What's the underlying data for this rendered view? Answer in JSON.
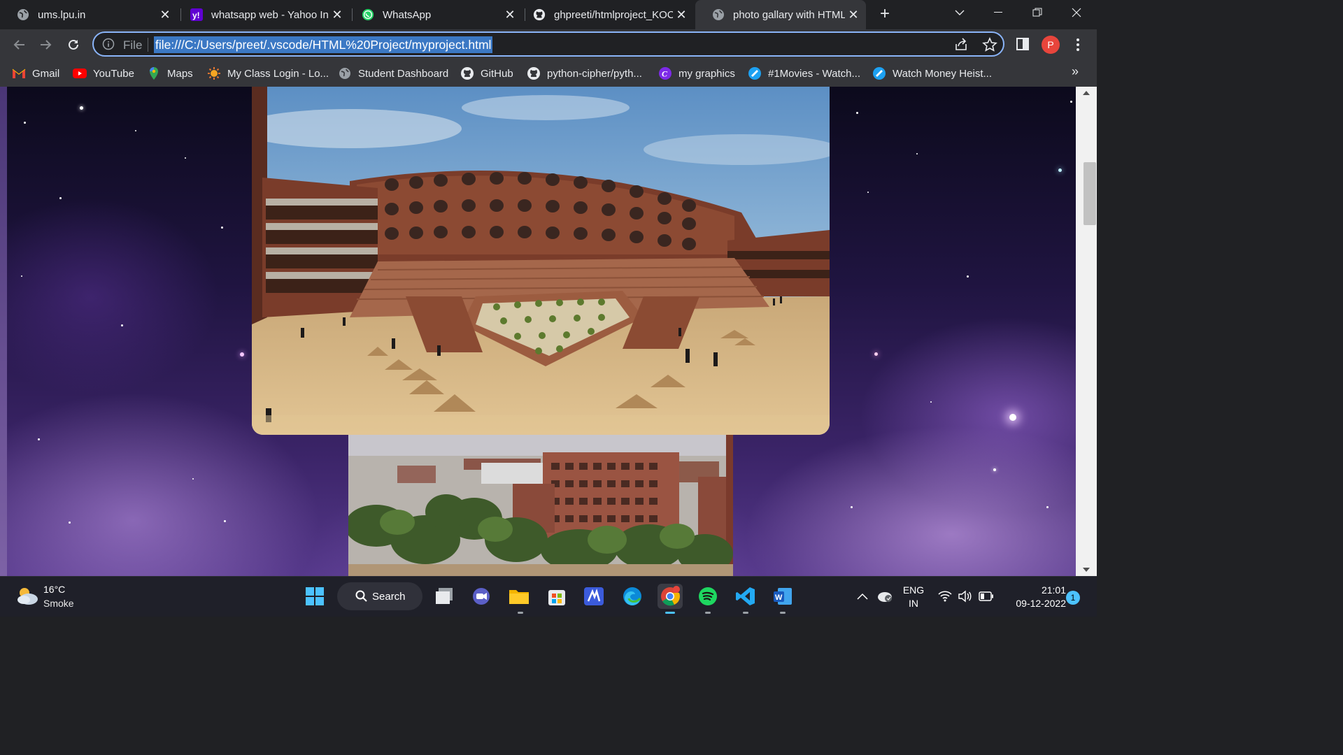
{
  "browser": {
    "tabs": [
      {
        "title": "ums.lpu.in",
        "icon": "globe-icon"
      },
      {
        "title": "whatsapp web - Yahoo Inc",
        "icon": "yahoo-icon"
      },
      {
        "title": "WhatsApp",
        "icon": "whatsapp-icon"
      },
      {
        "title": "ghpreeti/htmlproject_KOC",
        "icon": "github-icon"
      },
      {
        "title": "photo gallary with HTML",
        "icon": "globe-icon",
        "active": true
      }
    ],
    "omnibox": {
      "scheme_label": "File",
      "url": "file:///C:/Users/preet/.vscode/HTML%20Project/myproject.html"
    },
    "profile_initial": "P",
    "bookmarks": [
      {
        "label": "Gmail",
        "icon": "gmail-icon"
      },
      {
        "label": "YouTube",
        "icon": "youtube-icon"
      },
      {
        "label": "Maps",
        "icon": "maps-icon"
      },
      {
        "label": "My Class Login - Lo...",
        "icon": "sun-icon"
      },
      {
        "label": "Student Dashboard",
        "icon": "globe-icon"
      },
      {
        "label": "GitHub",
        "icon": "github-icon"
      },
      {
        "label": "python-cipher/pyth...",
        "icon": "github-icon"
      },
      {
        "label": "my graphics",
        "icon": "canva-icon"
      },
      {
        "label": "#1Movies - Watch...",
        "icon": "movies-icon"
      },
      {
        "label": "Watch Money Heist...",
        "icon": "movies-icon"
      }
    ],
    "bookmarks_overflow": "»"
  },
  "page": {
    "background": "starry purple nebula",
    "images": [
      {
        "subject": "campus courtyard with amphitheatre steps"
      },
      {
        "subject": "campus red-brick buildings among trees"
      }
    ]
  },
  "taskbar": {
    "weather": {
      "temp": "16°C",
      "condition": "Smoke"
    },
    "search_label": "Search",
    "apps": [
      "file-manager-icon",
      "meet-icon",
      "folder-icon",
      "store-icon",
      "design-app-icon",
      "edge-icon",
      "chrome-icon",
      "spotify-icon",
      "vscode-icon",
      "word-icon"
    ],
    "tray": {
      "language": "ENG",
      "region": "IN",
      "time": "21:01",
      "date": "09-12-2022",
      "notifications": "1"
    }
  }
}
